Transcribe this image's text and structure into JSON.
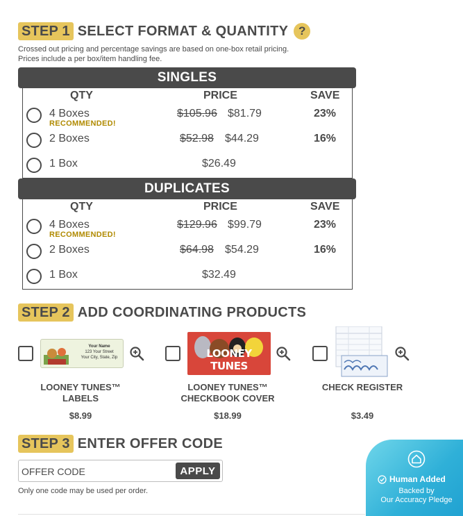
{
  "step1": {
    "badge": "STEP 1",
    "title": "SELECT FORMAT & QUANTITY",
    "help_icon_glyph": "?",
    "note_line1": "Crossed out pricing and percentage savings are based on one-box retail pricing.",
    "note_line2": "Prices include a per box/item handling fee.",
    "columns": {
      "qty": "QTY",
      "price": "PRICE",
      "save": "SAVE"
    },
    "singles": {
      "header": "SINGLES",
      "rows": [
        {
          "qty": "4 Boxes",
          "recommended": "RECOMMENDED!",
          "old_price": "$105.96",
          "price": "$81.79",
          "save": "23%"
        },
        {
          "qty": "2 Boxes",
          "old_price": "$52.98",
          "price": "$44.29",
          "save": "16%"
        },
        {
          "qty": "1 Box",
          "price": "$26.49"
        }
      ]
    },
    "duplicates": {
      "header": "DUPLICATES",
      "rows": [
        {
          "qty": "4 Boxes",
          "recommended": "RECOMMENDED!",
          "old_price": "$129.96",
          "price": "$99.79",
          "save": "23%"
        },
        {
          "qty": "2 Boxes",
          "old_price": "$64.98",
          "price": "$54.29",
          "save": "16%"
        },
        {
          "qty": "1 Box",
          "price": "$32.49"
        }
      ]
    }
  },
  "step2": {
    "badge": "STEP 2",
    "title": "ADD COORDINATING PRODUCTS",
    "products": [
      {
        "name_line1": "LOONEY TUNES™",
        "name_line2": "LABELS",
        "price": "$8.99",
        "label_text": [
          "Your Name",
          "123 Your Street",
          "Your City, State, Zip"
        ]
      },
      {
        "name_line1": "LOONEY TUNES™",
        "name_line2": "CHECKBOOK COVER",
        "price": "$18.99",
        "cover_text": "LOONEY TUNES"
      },
      {
        "name_line1": "CHECK REGISTER",
        "name_line2": "",
        "price": "$3.49"
      }
    ]
  },
  "step3": {
    "badge": "STEP 3",
    "title": "ENTER OFFER CODE",
    "input_placeholder": "OFFER CODE",
    "apply_label": "APPLY",
    "note": "Only one code may be used per order."
  },
  "pledge": {
    "title": "Human Added",
    "line1": "Backed by",
    "line2": "Our Accuracy Pledge"
  },
  "colors": {
    "accent": "#e6c55c",
    "dark": "#4a4a4a",
    "recommended": "#b08a00",
    "pledge": "#2fb0d8"
  }
}
